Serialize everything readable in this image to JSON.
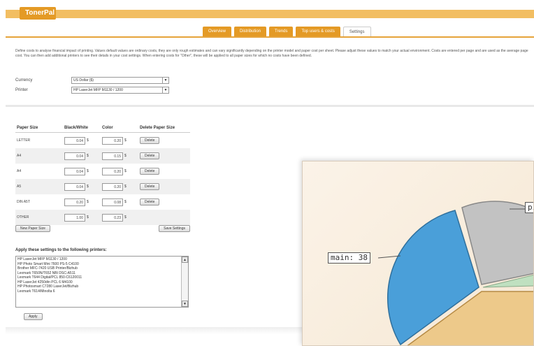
{
  "app": {
    "logo": "TonerPal"
  },
  "tabs": [
    {
      "label": "Overview"
    },
    {
      "label": "Distribution"
    },
    {
      "label": "Trends"
    },
    {
      "label": "Top users & costs"
    },
    {
      "label": "Settings"
    }
  ],
  "intro": {
    "text": "Define costs to analyse financial impact of printing. Values default values are ordinary costs, they are only rough estimates and can vary significantly depending on the printer model and paper cost per sheet. Please adjust these values to match your actual environment. Costs are entered per page and are used as the average page cost. You can then add additional printers to see their details in your cost settings. When entering costs for \"Other\", these will be applied to all paper sizes for which no costs have been defined."
  },
  "fields": {
    "currency": {
      "label": "Currency",
      "value": "US Dollar ($)"
    },
    "printer": {
      "label": "Printer",
      "value": "HP LaserJet MFP M1130 / 1200"
    }
  },
  "paper_table": {
    "headers": [
      "Paper Size",
      "Black/White",
      "Color",
      "Delete Paper Size"
    ],
    "unit": "$",
    "delete_label": "Delete",
    "rows": [
      {
        "size": "LETTER",
        "bw": "0.04",
        "color": "0.20"
      },
      {
        "size": "A4",
        "bw": "0.04",
        "color": "0.15"
      },
      {
        "size": "A4",
        "bw": "0.04",
        "color": "0.20"
      },
      {
        "size": "A5",
        "bw": "0.04",
        "color": "0.20"
      },
      {
        "size": "DIN A5T",
        "bw": "0.20",
        "color": "0.08"
      },
      {
        "size": "OTHER",
        "bw": "1.00",
        "color": "0.23"
      }
    ],
    "add_button": "New Paper Size",
    "save_button": "Save Settings"
  },
  "printers": {
    "label": "Apply these settings to the following printers:",
    "items": [
      "HP LaserJet MFP M1130 / 1200",
      "HP Photo Smart Mini 7600 PS-5 C4100",
      "Brother MFC-7420 USB Printer/Bizhub",
      "Lexmark T650N/T652 NBI DSC-A511",
      "Lexmark T644 Digital/PCL 850-C6120011",
      "HP LaserJet 4250dtn PCL 6 M4100",
      "HP Photosmart C7280 LaserJet/Bizhub",
      "Lexmark T614/Minolta 6"
    ],
    "apply_button": "Apply"
  },
  "chart_overlay": {
    "label_main": "main: 38",
    "label_partial": "pilo"
  },
  "colors": {
    "accent": "#e49a25",
    "header": "#f2be62",
    "slice_blue": "#4a9fd9",
    "slice_grey": "#c2c2c2",
    "slice_green": "#bfe0c0",
    "slice_tan": "#edc98a"
  }
}
